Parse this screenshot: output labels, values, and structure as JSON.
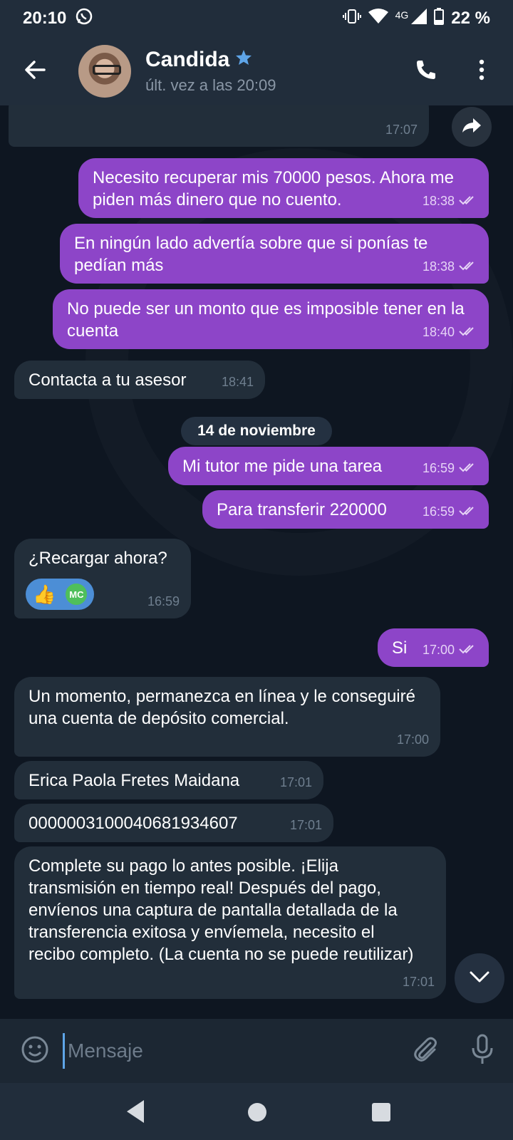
{
  "status_bar": {
    "time": "20:10",
    "network": "4G",
    "battery": "22 %"
  },
  "header": {
    "contact_name": "Candida",
    "last_seen": "últ. vez a las 20:09"
  },
  "chat": {
    "date_separator": "14 de noviembre",
    "messages": [
      {
        "dir": "in",
        "text": "",
        "time": "17:07"
      },
      {
        "dir": "out",
        "text": "Necesito recuperar mis 70000 pesos. Ahora me piden más dinero que no cuento.",
        "time": "18:38"
      },
      {
        "dir": "out",
        "text": "En ningún lado advertía sobre que si ponías te pedían más",
        "time": "18:38"
      },
      {
        "dir": "out",
        "text": "No puede ser un monto que es imposible tener en la cuenta",
        "time": "18:40"
      },
      {
        "dir": "in",
        "text": "Contacta a tu asesor",
        "time": "18:41"
      },
      {
        "dir": "out",
        "text": "Mi tutor me pide una tarea",
        "time": "16:59"
      },
      {
        "dir": "out",
        "text": "Para transferir 220000",
        "time": "16:59"
      },
      {
        "dir": "in",
        "text": "¿Recargar ahora?",
        "time": "16:59",
        "reaction": {
          "emoji": "👍",
          "user_initials": "MC"
        }
      },
      {
        "dir": "out",
        "text": "Si",
        "time": "17:00"
      },
      {
        "dir": "in",
        "text": "Un momento, permanezca en línea y le conseguiré una cuenta de depósito comercial.",
        "time": "17:00"
      },
      {
        "dir": "in",
        "text": "Erica Paola Fretes Maidana",
        "time": "17:01"
      },
      {
        "dir": "in",
        "text": "0000003100040681934607",
        "time": "17:01"
      },
      {
        "dir": "in",
        "text": "Complete su pago lo antes posible. ¡Elija transmisión en tiempo real! Después del pago, envíenos una captura de pantalla detallada de la transferencia exitosa y envíemela, necesito el recibo completo. (La cuenta no se puede reutilizar)",
        "time": "17:01"
      }
    ]
  },
  "composer": {
    "placeholder": "Mensaje"
  },
  "colors": {
    "outgoing_bubble": "#8d45c8",
    "incoming_bubble": "#222e3a",
    "chat_background": "#0e1621",
    "header": "#212d3b",
    "accent": "#5ea5e8"
  },
  "icons": [
    "whatsapp-icon",
    "vibrate-icon",
    "wifi-icon",
    "signal-icon",
    "battery-icon",
    "back-arrow-icon",
    "verified-star-icon",
    "phone-icon",
    "more-vert-icon",
    "share-icon",
    "double-check-icon",
    "chevron-down-icon",
    "emoji-icon",
    "attach-icon",
    "mic-icon"
  ]
}
